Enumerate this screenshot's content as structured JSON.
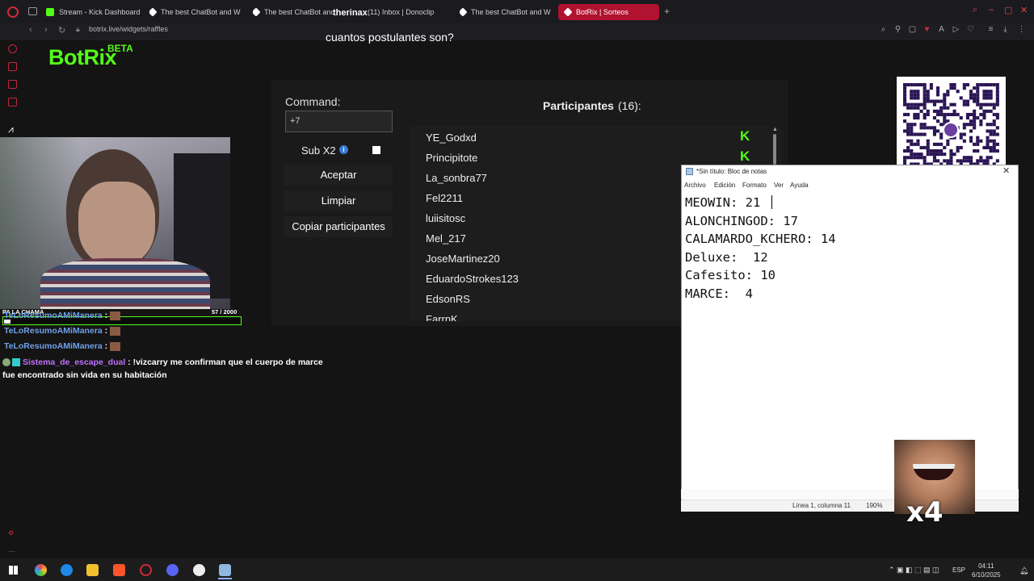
{
  "browser": {
    "tabs": [
      {
        "label": "Stream - Kick Dashboard",
        "color": "#53fc18"
      },
      {
        "label": "The best ChatBot and W",
        "color": "#ffffff"
      },
      {
        "label": "The best ChatBot and W",
        "color": "#ffffff"
      },
      {
        "label": "(11) Inbox | Donoclip",
        "color": "#ffffff"
      },
      {
        "label": "The best ChatBot and W",
        "color": "#ffffff"
      },
      {
        "label": "BotRix | Sorteos",
        "color": "#ffffff"
      }
    ],
    "url": "botrix.live/widgets/raffles",
    "overlay_logo": "therinax"
  },
  "page": {
    "logo": "BotRix",
    "logo_badge": "BETA",
    "question": "cuantos postulantes son?",
    "command_label": "Command:",
    "command_value": "+7",
    "sub_label": "Sub X2",
    "buttons": {
      "accept": "Aceptar",
      "clear": "Limpiar",
      "copy": "Copiar participantes"
    },
    "participants_title": "Participantes",
    "participants_count": "(16):",
    "participants": [
      "YE_Godxd",
      "Principitote",
      "La_sonbra77",
      "Fel2211",
      "luiisitosc",
      "Mel_217",
      "JoseMartinez20",
      "EduardoStrokes123",
      "EdsonRS",
      "FarrnK"
    ],
    "accent": "#53fc18"
  },
  "notepad": {
    "title": "*Sin título: Bloc de notas",
    "menu": [
      "Archivo",
      "Edición",
      "Formato",
      "Ver",
      "Ayuda"
    ],
    "lines": [
      "MEOWIN: 21",
      "ALONCHINGOD: 17",
      "CALAMARDO_KCHERO: 14",
      "Deluxe:  12",
      "Cafesito: 10",
      "MARCE:  4"
    ],
    "cursor_pos": "Línea 1, columna 11",
    "zoom": "190%"
  },
  "stream": {
    "goal_label": "PA LA CHAMA",
    "goal_count": "57 / 2000",
    "goal_fraction": 0.0285,
    "chat": [
      {
        "name": "TeLoResumoAMiManera",
        "suffix": " :"
      },
      {
        "name": "TeLoResumoAMiManera",
        "suffix": " :"
      },
      {
        "name": "TeLoResumoAMiManera",
        "suffix": " :"
      }
    ],
    "chat_message": {
      "name": "Sistema_de_escape_dual",
      "text": " : !vizcarry me confirman que el cuerpo de marce fue encontrado sin vida en su habitación"
    },
    "meme_text": "x4"
  },
  "taskbar": {
    "lang": "ESP",
    "time": "04:11",
    "date": "6/10/2025"
  }
}
